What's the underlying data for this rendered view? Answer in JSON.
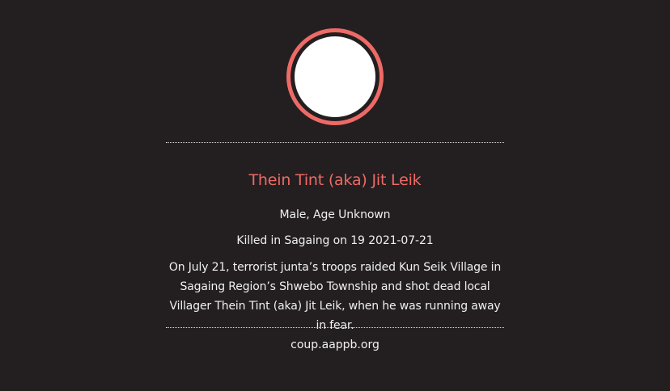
{
  "profile": {
    "name": "Thein Tint (aka) Jit Leik",
    "gender_age": "Male, Age Unknown",
    "killed_line": "Killed in Sagaing on 19 2021-07-21",
    "description": "On July 21, terrorist junta’s troops raided Kun Seik Village in Sagaing Region’s Shwebo Township and shot dead local Villager Thein Tint (aka) Jit Leik, when he was running away in fear.",
    "source": "coup.aappb.org"
  },
  "colors": {
    "background": "#231f20",
    "accent": "#ee6a66",
    "text": "#f0f0f0",
    "avatar_fill": "#ffffff"
  }
}
